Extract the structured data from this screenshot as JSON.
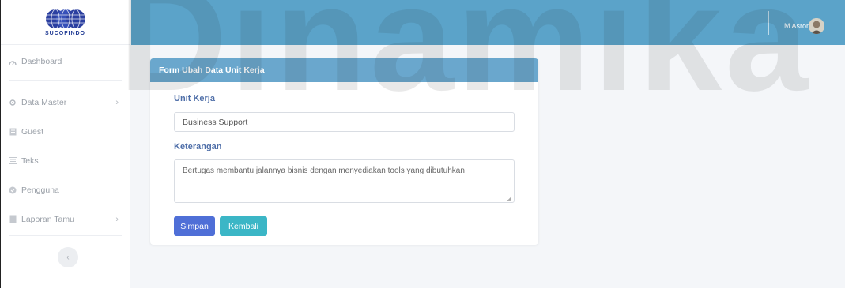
{
  "brand": {
    "name": "SUCOFINDO"
  },
  "sidebar": {
    "items": [
      {
        "label": "Dashboard",
        "icon": "dashboard-icon",
        "has_chevron": false
      },
      {
        "label": "Data Master",
        "icon": "gear-icon",
        "has_chevron": true
      },
      {
        "label": "Guest",
        "icon": "guest-icon",
        "has_chevron": false
      },
      {
        "label": "Teks",
        "icon": "text-icon",
        "has_chevron": false
      },
      {
        "label": "Pengguna",
        "icon": "user-icon",
        "has_chevron": false
      },
      {
        "label": "Laporan Tamu",
        "icon": "report-icon",
        "has_chevron": true
      }
    ],
    "chevron": "›",
    "toggle": "‹"
  },
  "topbar": {
    "user_name": "M Asron",
    "color": "#5ba3c9"
  },
  "form": {
    "title": "Form Ubah Data Unit Kerja",
    "unit_kerja_label": "Unit Kerja",
    "unit_kerja_value": "Business Support",
    "keterangan_label": "Keterangan",
    "keterangan_value": "Bertugas membantu jalannya bisnis dengan menyediakan tools yang dibutuhkan",
    "save_label": "Simpan",
    "back_label": "Kembali"
  },
  "watermark": {
    "text": "Dinamika"
  },
  "colors": {
    "save": "#4f6fd7",
    "back": "#3bb6c6",
    "header": "#6aa7cd"
  }
}
